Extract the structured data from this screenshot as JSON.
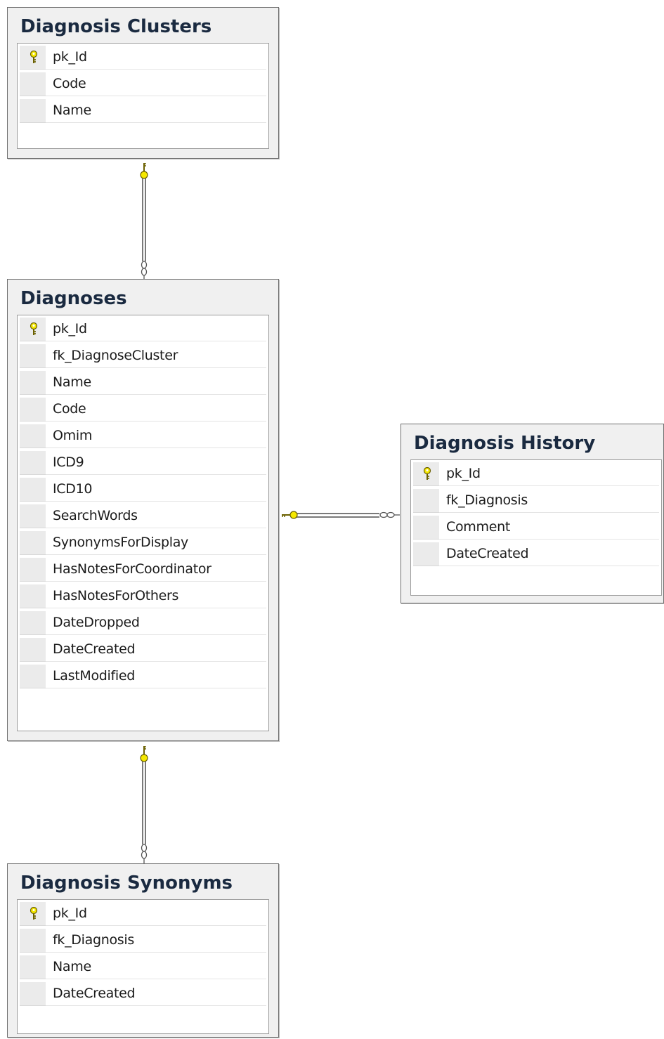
{
  "colors": {
    "key": "#f5e800",
    "key_outline": "#6b6000",
    "line": "#7a7a7a",
    "title": "#1a2a40"
  },
  "icons": {
    "primary_key": "key-icon",
    "relationship_one": "key-end-icon",
    "relationship_many": "infinity-end-icon"
  },
  "tables": {
    "clusters": {
      "title": "Diagnosis Clusters",
      "columns": [
        {
          "name": "pk_Id",
          "primary_key": true
        },
        {
          "name": "Code"
        },
        {
          "name": "Name"
        }
      ]
    },
    "diagnoses": {
      "title": "Diagnoses",
      "columns": [
        {
          "name": "pk_Id",
          "primary_key": true
        },
        {
          "name": "fk_DiagnoseCluster"
        },
        {
          "name": "Name"
        },
        {
          "name": "Code"
        },
        {
          "name": "Omim"
        },
        {
          "name": "ICD9"
        },
        {
          "name": "ICD10"
        },
        {
          "name": "SearchWords"
        },
        {
          "name": "SynonymsForDisplay"
        },
        {
          "name": "HasNotesForCoordinator"
        },
        {
          "name": "HasNotesForOthers"
        },
        {
          "name": "DateDropped"
        },
        {
          "name": "DateCreated"
        },
        {
          "name": "LastModified"
        }
      ]
    },
    "history": {
      "title": "Diagnosis History",
      "columns": [
        {
          "name": "pk_Id",
          "primary_key": true
        },
        {
          "name": "fk_Diagnosis"
        },
        {
          "name": "Comment"
        },
        {
          "name": "DateCreated"
        }
      ]
    },
    "synonyms": {
      "title": "Diagnosis Synonyms",
      "columns": [
        {
          "name": "pk_Id",
          "primary_key": true
        },
        {
          "name": "fk_Diagnosis"
        },
        {
          "name": "Name"
        },
        {
          "name": "DateCreated"
        }
      ]
    }
  },
  "relationships": [
    {
      "from": "clusters",
      "to": "diagnoses",
      "one_end": "clusters",
      "many_end": "diagnoses"
    },
    {
      "from": "diagnoses",
      "to": "history",
      "one_end": "diagnoses",
      "many_end": "history"
    },
    {
      "from": "diagnoses",
      "to": "synonyms",
      "one_end": "diagnoses",
      "many_end": "synonyms"
    }
  ]
}
